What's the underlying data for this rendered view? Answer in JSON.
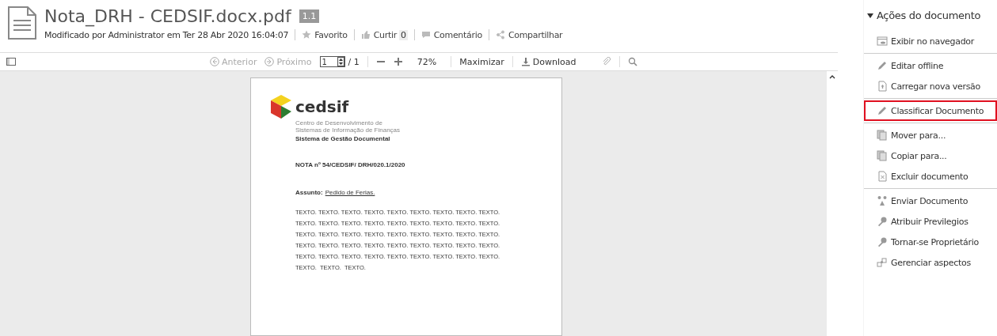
{
  "header": {
    "title": "Nota_DRH - CEDSIF.docx.pdf",
    "version": "1.1",
    "modified": "Modificado por Administrator em Ter 28 Abr 2020 16:04:07",
    "actions": [
      {
        "kind": "star",
        "label": "Favorito"
      },
      {
        "kind": "like",
        "label": "Curtir",
        "count": "0"
      },
      {
        "kind": "comment",
        "label": "Comentário"
      },
      {
        "kind": "share",
        "label": "Compartilhar"
      }
    ]
  },
  "toolbar": {
    "previous": {
      "label": "Anterior",
      "disabled": true
    },
    "next": {
      "label": "Próximo",
      "disabled": true
    },
    "page": "1",
    "total": "/ 1",
    "zoom": "72%",
    "maximize": "Maximizar",
    "download": "Download"
  },
  "document": {
    "logo": "cedsif",
    "logo_subtitle": [
      "Centro de Desenvolvimento de",
      "Sistemas de Informação de Finanças"
    ],
    "system": "Sistema de Gestão Documental",
    "note": "NOTA nº 54/CEDSIF/ DRH/020.1/2020",
    "subject_label": "Assunto:",
    "subject": "Pedido de Ferias.",
    "body": [
      "TEXTO. TEXTO. TEXTO. TEXTO. TEXTO. TEXTO. TEXTO. TEXTO. TEXTO.",
      "TEXTO. TEXTO. TEXTO. TEXTO. TEXTO. TEXTO. TEXTO. TEXTO. TEXTO.",
      "TEXTO. TEXTO. TEXTO. TEXTO. TEXTO. TEXTO. TEXTO. TEXTO. TEXTO.",
      "TEXTO. TEXTO. TEXTO. TEXTO. TEXTO. TEXTO. TEXTO. TEXTO. TEXTO.",
      "TEXTO. TEXTO. TEXTO. TEXTO. TEXTO. TEXTO. TEXTO. TEXTO. TEXTO.",
      "TEXTO.  TEXTO.  TEXTO."
    ]
  },
  "actions_panel": {
    "title": "Ações do documento",
    "expanded": true,
    "groups": [
      [
        {
          "kind": "view",
          "label": "Exibir no navegador",
          "highlighted": false
        }
      ],
      [
        {
          "kind": "edit",
          "label": "Editar offline",
          "highlighted": false
        },
        {
          "kind": "upload",
          "label": "Carregar nova versão",
          "highlighted": false
        }
      ],
      [
        {
          "kind": "edit",
          "label": "Classificar Documento",
          "highlighted": true
        }
      ],
      [
        {
          "kind": "copy",
          "label": "Mover para...",
          "highlighted": false
        },
        {
          "kind": "copy",
          "label": "Copiar para...",
          "highlighted": false
        },
        {
          "kind": "delete",
          "label": "Excluir documento",
          "highlighted": false
        }
      ],
      [
        {
          "kind": "send",
          "label": "Enviar Documento",
          "highlighted": false
        },
        {
          "kind": "key",
          "label": "Atribuir Previlegios",
          "highlighted": false
        },
        {
          "kind": "key",
          "label": "Tornar-se Proprietário",
          "highlighted": false
        },
        {
          "kind": "aspects",
          "label": "Gerenciar aspectos",
          "highlighted": false
        }
      ]
    ]
  }
}
